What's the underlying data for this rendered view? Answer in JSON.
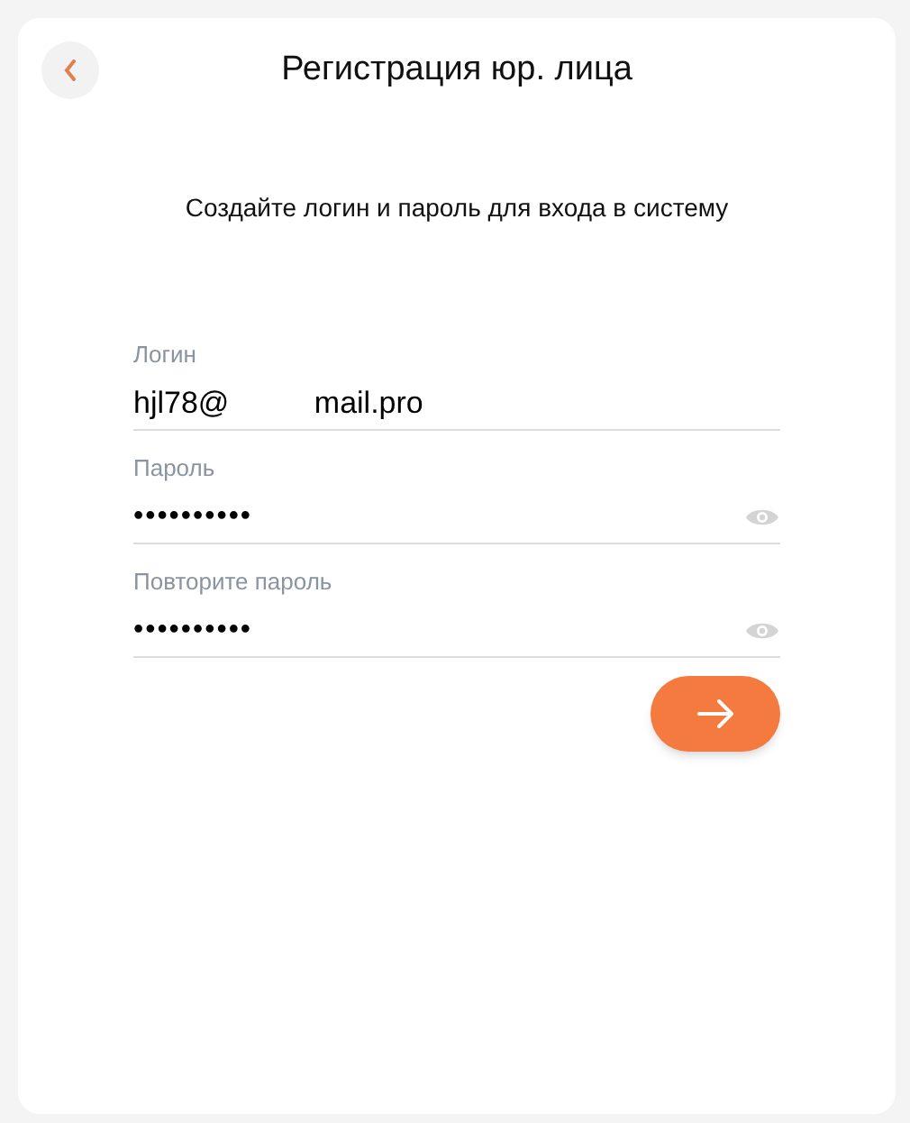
{
  "header": {
    "title": "Регистрация юр. лица"
  },
  "subtitle": "Создайте логин и пароль для входа в систему",
  "fields": [
    {
      "kind": "text",
      "label": "Логин",
      "value": "hjl78@          mail.pro"
    },
    {
      "kind": "password",
      "label": "Пароль",
      "value": "••••••••••"
    },
    {
      "kind": "password",
      "label": "Повторите пароль",
      "value": "••••••••••"
    }
  ]
}
